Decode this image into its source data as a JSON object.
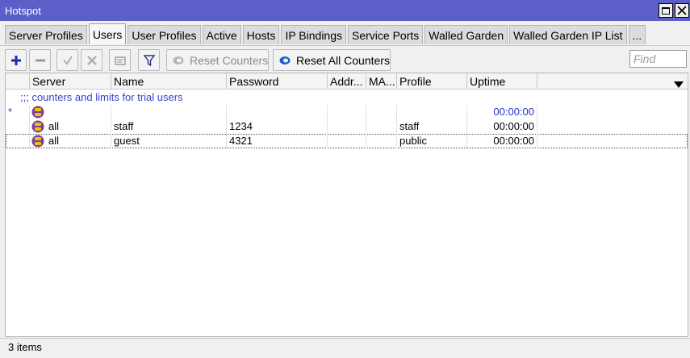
{
  "window": {
    "title": "Hotspot"
  },
  "tabs": [
    {
      "label": "Server Profiles"
    },
    {
      "label": "Users",
      "active": true
    },
    {
      "label": "User Profiles"
    },
    {
      "label": "Active"
    },
    {
      "label": "Hosts"
    },
    {
      "label": "IP Bindings"
    },
    {
      "label": "Service Ports"
    },
    {
      "label": "Walled Garden"
    },
    {
      "label": "Walled Garden IP List"
    },
    {
      "label": "..."
    }
  ],
  "toolbar": {
    "reset_counters_label": "Reset Counters",
    "reset_all_counters_label": "Reset All Counters",
    "find_placeholder": "Find",
    "find_value": ""
  },
  "table": {
    "columns": [
      "Server",
      "Name",
      "Password",
      "Addr...",
      "MA...",
      "Profile",
      "Uptime"
    ],
    "comment": ";;; counters and limits for trial users",
    "rows": [
      {
        "flag": "*",
        "server": "",
        "name": "",
        "password": "",
        "address": "",
        "mac": "",
        "profile": "",
        "uptime": "00:00:00"
      },
      {
        "flag": "",
        "server": "all",
        "name": "staff",
        "password": "1234",
        "address": "",
        "mac": "",
        "profile": "staff",
        "uptime": "00:00:00"
      },
      {
        "flag": "",
        "server": "all",
        "name": "guest",
        "password": "4321",
        "address": "",
        "mac": "",
        "profile": "public",
        "uptime": "00:00:00"
      }
    ]
  },
  "status": {
    "item_count": "3 items"
  },
  "icons": {
    "add": "plus-icon",
    "remove": "minus-icon",
    "enable": "check-icon",
    "disable": "x-icon",
    "comment": "comment-icon",
    "filter": "filter-icon",
    "user": "user-icon",
    "reset": "reset-icon"
  },
  "colors": {
    "titlebar": "#5b5fc7",
    "accent_blue": "#2b2fc7",
    "user_icon_purple": "#7a3fa0",
    "user_icon_yellow": "#f2c200"
  }
}
